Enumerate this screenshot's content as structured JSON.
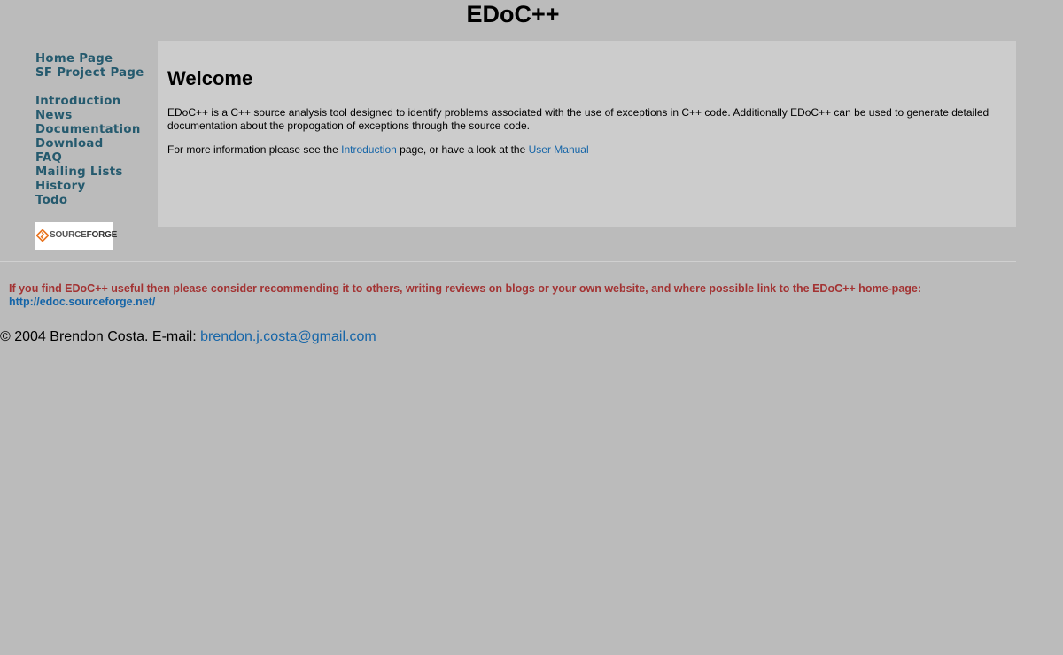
{
  "header": {
    "title": "EDoC++"
  },
  "sidebar": {
    "groups": [
      {
        "items": [
          {
            "label": "Home Page"
          },
          {
            "label": "SF Project Page"
          }
        ]
      },
      {
        "items": [
          {
            "label": "Introduction"
          },
          {
            "label": "News"
          },
          {
            "label": "Documentation"
          },
          {
            "label": "Download"
          },
          {
            "label": "FAQ"
          },
          {
            "label": "Mailing Lists"
          },
          {
            "label": "History"
          },
          {
            "label": "Todo"
          }
        ]
      }
    ],
    "logo": {
      "text_light": "SOURCE",
      "text_bold": "FORGE",
      "icon": "sourceforge-diamond-icon",
      "accent_color": "#e8731e"
    }
  },
  "main": {
    "heading": "Welcome",
    "intro": "EDoC++ is a C++ source analysis tool designed to identify problems associated with the use of exceptions in C++ code. Additionally EDoC++ can be used to generate detailed documentation about the propogation of exceptions through the source code.",
    "more_prefix": "For more information please see the ",
    "intro_link": "Introduction",
    "more_middle": " page, or have a look at the ",
    "manual_link": "User Manual"
  },
  "promo": {
    "text": "If you find EDoC++ useful then please consider recommending it to others, writing reviews on blogs or your own website, and where possible link to the EDoC++ home-page:",
    "link": "http://edoc.sourceforge.net/"
  },
  "footer": {
    "copyright": "© 2004 Brendon Costa. E-mail: ",
    "email": "brendon.j.costa@gmail.com"
  },
  "colors": {
    "background": "#bbbbbb",
    "content_panel": "#cccccc",
    "nav_link": "#255a6e",
    "link": "#1565a8",
    "promo_text": "#a33333"
  }
}
